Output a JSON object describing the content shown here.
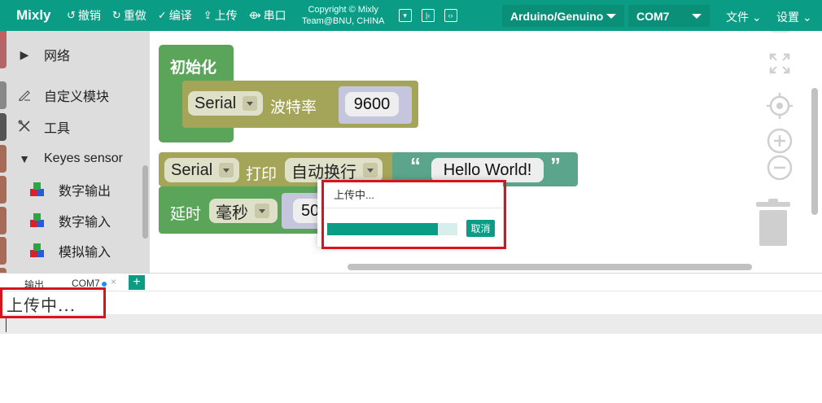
{
  "topbar": {
    "brand": "Mixly",
    "undo": "撤销",
    "redo": "重做",
    "compile": "编译",
    "upload": "上传",
    "serial": "串口",
    "copyright_line1": "Copyright © Mixly",
    "copyright_line2": "Team@BNU, CHINA",
    "board": "Arduino/Genuino",
    "port": "COM7",
    "file_menu": "文件",
    "settings_menu": "设置",
    "colors": {
      "accent": "#0b9c85"
    }
  },
  "sidebar": {
    "items": [
      {
        "label": "网络",
        "lead": "▶",
        "color": "#b46565"
      },
      {
        "label": "自定义模块",
        "lead": "pen",
        "color": "#888888"
      },
      {
        "label": "工具",
        "lead": "tools",
        "color": "#555555"
      },
      {
        "label": "Keyes sensor",
        "lead": "▼",
        "color": "#a86b58"
      }
    ],
    "subitems": [
      {
        "label": "数字输出"
      },
      {
        "label": "数字输入"
      },
      {
        "label": "模拟输入"
      }
    ]
  },
  "workspace": {
    "init_block": {
      "label": "初始化"
    },
    "serial_block": {
      "object": "Serial",
      "label": "波特率",
      "value": "9600"
    },
    "print_block": {
      "object": "Serial",
      "label": "打印",
      "mode": "自动换行",
      "text": "Hello World!"
    },
    "delay_block": {
      "label": "延时",
      "unit": "毫秒",
      "value": "50"
    }
  },
  "dialog": {
    "title": "上传中...",
    "progress": 0.85,
    "cancel": "取消"
  },
  "bottom": {
    "tab_output": "输出",
    "tab_port": "COM7",
    "add": "+",
    "output_text": "上传中..."
  }
}
